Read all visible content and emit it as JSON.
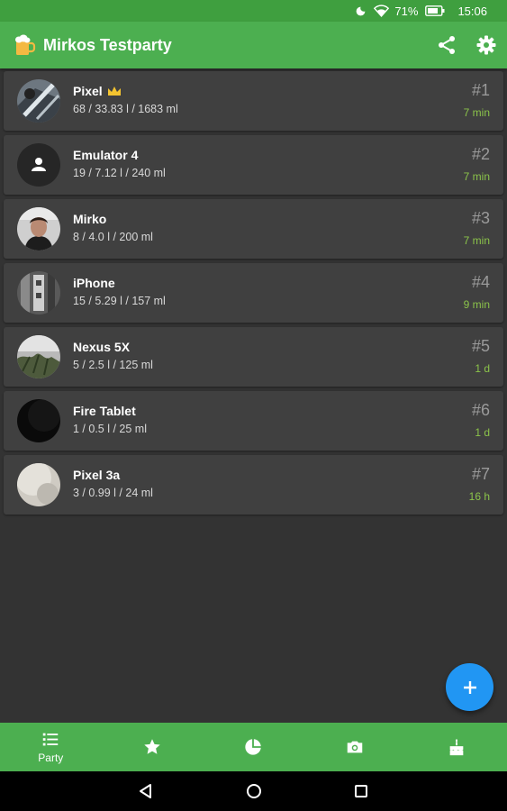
{
  "status_bar": {
    "battery": "71%",
    "time": "15:06"
  },
  "app_bar": {
    "title": "Mirkos Testparty"
  },
  "players": [
    {
      "name": "Pixel",
      "crown": true,
      "stats": "68 / 33.83 l / 1683 ml",
      "rank": "#1",
      "time": "7 min"
    },
    {
      "name": "Emulator 4",
      "crown": false,
      "stats": "19 / 7.12 l / 240 ml",
      "rank": "#2",
      "time": "7 min"
    },
    {
      "name": "Mirko",
      "crown": false,
      "stats": "8 / 4.0 l / 200 ml",
      "rank": "#3",
      "time": "7 min"
    },
    {
      "name": "iPhone",
      "crown": false,
      "stats": "15 / 5.29 l / 157 ml",
      "rank": "#4",
      "time": "9 min"
    },
    {
      "name": "Nexus 5X",
      "crown": false,
      "stats": "5 / 2.5 l / 125 ml",
      "rank": "#5",
      "time": "1 d"
    },
    {
      "name": "Fire Tablet",
      "crown": false,
      "stats": "1 / 0.5 l / 25 ml",
      "rank": "#6",
      "time": "1 d"
    },
    {
      "name": "Pixel 3a",
      "crown": false,
      "stats": "3 / 0.99 l / 24 ml",
      "rank": "#7",
      "time": "16 h"
    }
  ],
  "bottom_nav": {
    "party_label": "Party"
  },
  "colors": {
    "primary": "#4caf50",
    "status_bar": "#3f9f3f",
    "background": "#333333",
    "card": "#404040",
    "fab": "#2196f3",
    "time_accent": "#8bc34a"
  }
}
